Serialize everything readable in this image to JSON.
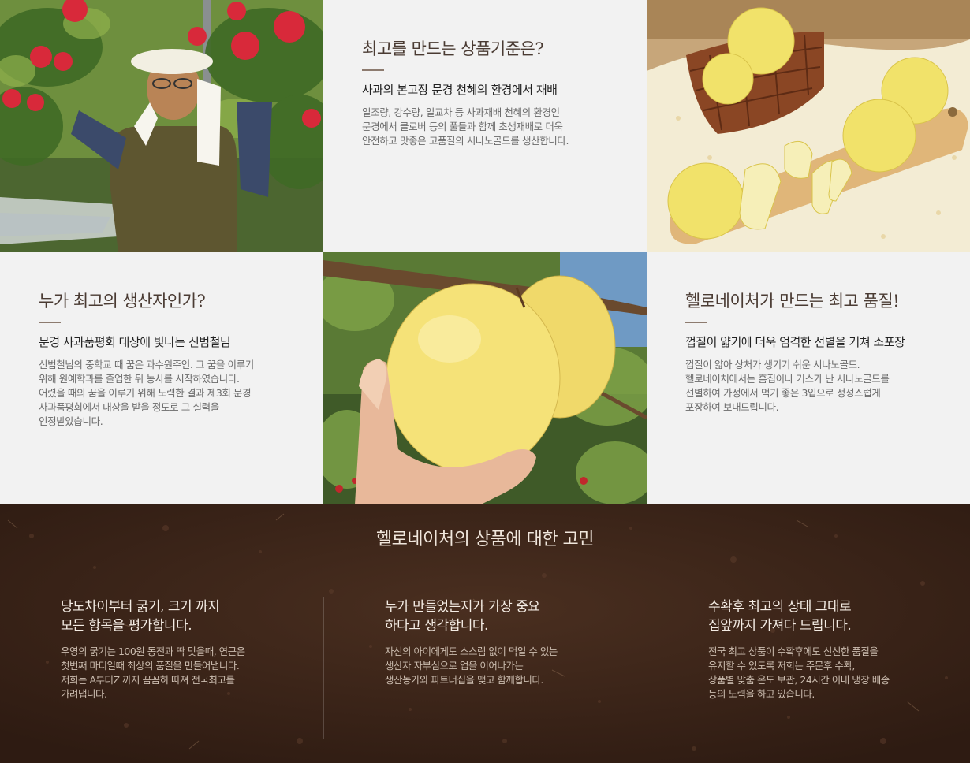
{
  "blocks": {
    "standard": {
      "title": "최고를 만드는 상품기준은?",
      "subtitle": "사과의 본고장 문경 천혜의 환경에서 재배",
      "body": "일조량, 강수량, 일교차 등 사과재배 천혜의 환경인\n문경에서 클로버 등의 풀들과 함께 초생재배로 더욱\n안전하고 맛좋은 고품질의 시나노골드를 생산합니다."
    },
    "producer": {
      "title": "누가 최고의 생산자인가?",
      "subtitle": "문경 사과품평회 대상에 빛나는 신범철님",
      "body": "신범철님의 중학교 때 꿈은 과수원주인. 그 꿈을 이루기\n위해 원예학과를 졸업한 뒤 농사를 시작하였습니다.\n어렸을 때의 꿈을 이루기 위해 노력한 결과 제3회 문경\n사과품평회에서 대상을 받을 정도로 그 실력을\n인정받았습니다."
    },
    "quality": {
      "title": "헬로네이처가 만드는 최고 품질!",
      "subtitle": "껍질이 얇기에 더욱 엄격한 선별을 거쳐 소포장",
      "body": "껍질이 얇아 상처가 생기기 쉬운 시나노골드.\n헬로네이처에서는 흠집이나 기스가 난 시나노골드를\n선별하여 가정에서 먹기 좋은 3입으로 정성스럽게\n포장하여 보내드립니다."
    }
  },
  "concerns": {
    "title": "헬로네이처의 상품에 대한 고민",
    "columns": [
      {
        "heading": "당도차이부터 굵기, 크기 까지\n모든 항목을 평가합니다.",
        "body": "우영의 굵기는 100원 동전과 딱 맞을때, 연근은\n첫번째 마디일때 최상의 품질을 만들어냅니다.\n저희는 A부터Z 까지 꼼꼼히 따져 전국최고를\n가려냅니다."
      },
      {
        "heading": "누가 만들었는지가 가장 중요\n하다고 생각합니다.",
        "body": "자신의 아이에게도 스스럼 없이 먹일 수 있는\n생산자 자부심으로 업을 이어나가는\n생산농가와 파트너십을 맺고 함께합니다."
      },
      {
        "heading": "수확후 최고의 상태 그대로\n집앞까지 가져다 드립니다.",
        "body": "전국 최고 상품이 수확후에도 신선한 품질을\n유지할 수 있도록 저희는 주문후 수확,\n상품별 맞춤 온도 보관, 24시간 이내 냉장 배송\n등의 노력을 하고 있습니다."
      }
    ]
  },
  "colors": {
    "panel_bg": "#f2f2f2",
    "heading_brown": "#4a3b33",
    "soil_brown": "#3b2519",
    "apple_yellow": "#f1e26a",
    "apple_red": "#d8293a"
  }
}
